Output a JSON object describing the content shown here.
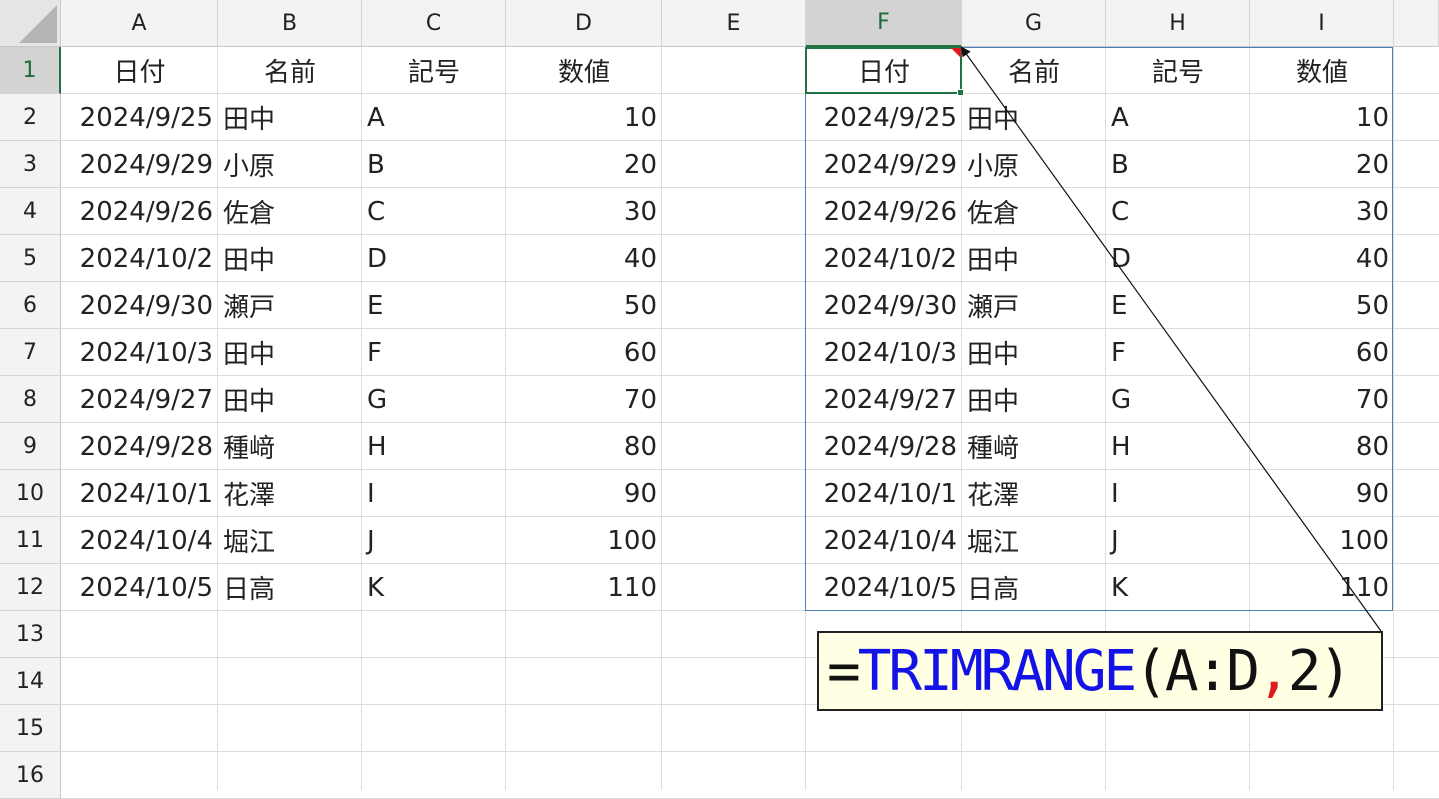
{
  "sheet": {
    "columns": [
      "A",
      "B",
      "C",
      "D",
      "E",
      "F",
      "G",
      "H",
      "I"
    ],
    "rows": [
      "1",
      "2",
      "3",
      "4",
      "5",
      "6",
      "7",
      "8",
      "9",
      "10",
      "11",
      "12",
      "13",
      "14",
      "15",
      "16"
    ],
    "selected_column": "F",
    "selected_row": "1"
  },
  "source_table": {
    "headers": [
      "日付",
      "名前",
      "記号",
      "数値"
    ],
    "rows": [
      [
        "2024/9/25",
        "田中",
        "A",
        "10"
      ],
      [
        "2024/9/29",
        "小原",
        "B",
        "20"
      ],
      [
        "2024/9/26",
        "佐倉",
        "C",
        "30"
      ],
      [
        "2024/10/2",
        "田中",
        "D",
        "40"
      ],
      [
        "2024/9/30",
        "瀬戸",
        "E",
        "50"
      ],
      [
        "2024/10/3",
        "田中",
        "F",
        "60"
      ],
      [
        "2024/9/27",
        "田中",
        "G",
        "70"
      ],
      [
        "2024/9/28",
        "種﨑",
        "H",
        "80"
      ],
      [
        "2024/10/1",
        "花澤",
        "I",
        "90"
      ],
      [
        "2024/10/4",
        "堀江",
        "J",
        "100"
      ],
      [
        "2024/10/5",
        "日高",
        "K",
        "110"
      ]
    ]
  },
  "spill_table": {
    "headers": [
      "日付",
      "名前",
      "記号",
      "数値"
    ],
    "rows": [
      [
        "2024/9/25",
        "田中",
        "A",
        "10"
      ],
      [
        "2024/9/29",
        "小原",
        "B",
        "20"
      ],
      [
        "2024/9/26",
        "佐倉",
        "C",
        "30"
      ],
      [
        "2024/10/2",
        "田中",
        "D",
        "40"
      ],
      [
        "2024/9/30",
        "瀬戸",
        "E",
        "50"
      ],
      [
        "2024/10/3",
        "田中",
        "F",
        "60"
      ],
      [
        "2024/9/27",
        "田中",
        "G",
        "70"
      ],
      [
        "2024/9/28",
        "種﨑",
        "H",
        "80"
      ],
      [
        "2024/10/1",
        "花澤",
        "I",
        "90"
      ],
      [
        "2024/10/4",
        "堀江",
        "J",
        "100"
      ],
      [
        "2024/10/5",
        "日高",
        "K",
        "110"
      ]
    ]
  },
  "formula_callout": {
    "equals": "=",
    "function": "TRIMRANGE",
    "open": "(",
    "range": "A:D",
    "comma": ",",
    "arg2": "2",
    "close": ")"
  },
  "colors": {
    "selection_green": "#217346",
    "spill_border": "#4a7fb5",
    "function_blue": "#1313e8",
    "comma_red": "#e0191a",
    "callout_bg": "#ffffe4"
  }
}
